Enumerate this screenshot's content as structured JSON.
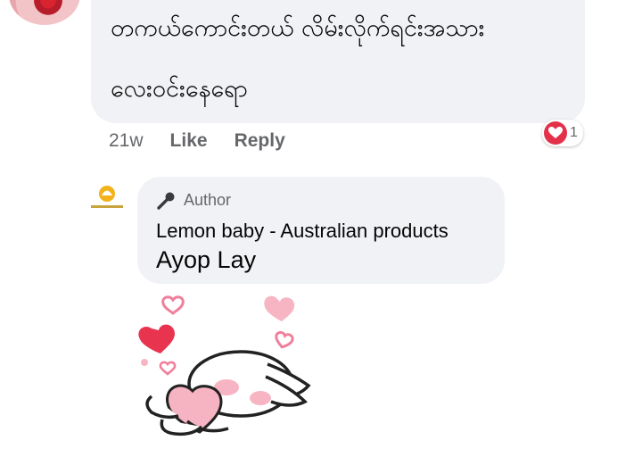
{
  "comment": {
    "line1": "တကယ်ကောင်းတယ် လိမ်းလိုက်ရင်းအသား",
    "line2": "လေးဝင်းနေရော",
    "time": "21w",
    "like_label": "Like",
    "reply_label": "Reply",
    "reaction_icon": "heart-icon",
    "reaction_count": "1"
  },
  "reply": {
    "badge_icon": "microphone-icon",
    "badge_label": "Author",
    "page_name": "Lemon baby - Australian products",
    "text": "Ayop Lay",
    "sticker": "bunny-hugging-heart-sticker"
  },
  "colors": {
    "bubble": "#f0f2f5",
    "meta_text": "#65676b",
    "primary_text": "#050505",
    "reaction": "#e4314a"
  }
}
